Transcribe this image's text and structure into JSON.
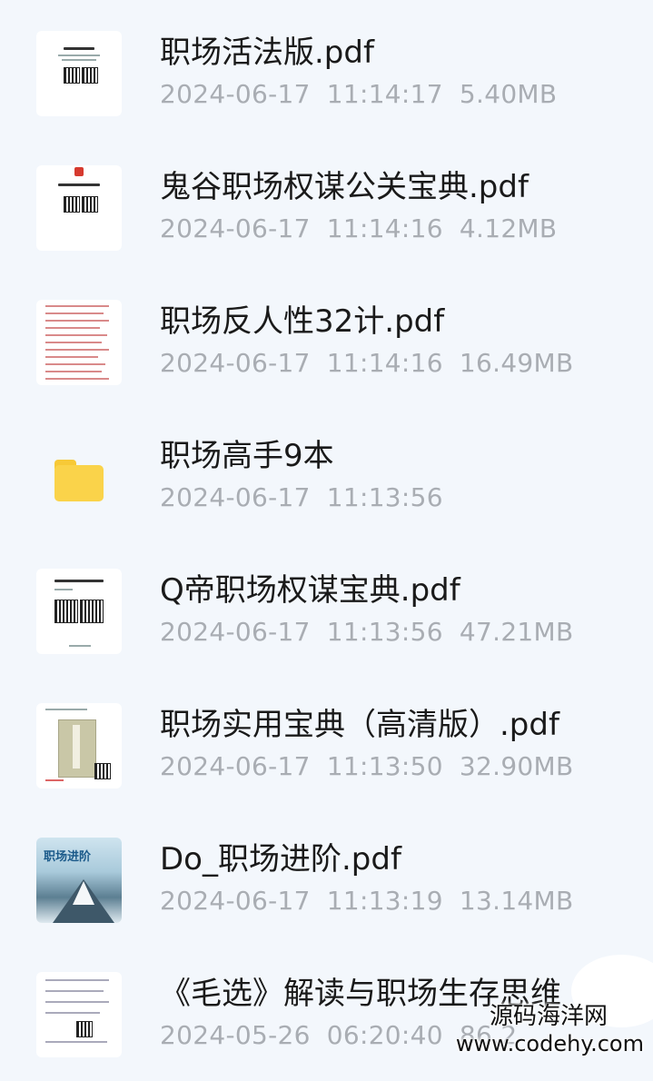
{
  "files": [
    {
      "name": "职场活法版.pdf",
      "date": "2024-06-17",
      "time": "11:14:17",
      "size": "5.40MB",
      "thumb": "pdf-qr-thumbnail"
    },
    {
      "name": "鬼谷职场权谋公关宝典.pdf",
      "date": "2024-06-17",
      "time": "11:14:16",
      "size": "4.12MB",
      "thumb": "pdf-qr-thumbnail"
    },
    {
      "name": "职场反人性32计.pdf",
      "date": "2024-06-17",
      "time": "11:14:16",
      "size": "16.49MB",
      "thumb": "pdf-list-thumbnail"
    },
    {
      "name": "职场高手9本",
      "date": "2024-06-17",
      "time": "11:13:56",
      "size": "",
      "thumb": "folder-icon"
    },
    {
      "name": "Q帝职场权谋宝典.pdf",
      "date": "2024-06-17",
      "time": "11:13:56",
      "size": "47.21MB",
      "thumb": "pdf-qr-thumbnail"
    },
    {
      "name": "职场实用宝典（高清版）.pdf",
      "date": "2024-06-17",
      "time": "11:13:50",
      "size": "32.90MB",
      "thumb": "pdf-book-thumbnail"
    },
    {
      "name": "Do_职场进阶.pdf",
      "date": "2024-06-17",
      "time": "11:13:19",
      "size": "13.14MB",
      "thumb": "pdf-mountain-thumbnail"
    },
    {
      "name": "《毛选》解读与职场生存思维",
      "date": "2024-05-26",
      "time": "06:20:40",
      "size": "86.2",
      "thumb": "pdf-list-thumbnail"
    }
  ],
  "watermark": {
    "cn": "源码海洋网",
    "url": "www.codehy.com"
  },
  "colors": {
    "background": "#f3f7fc",
    "name_text": "#1a1a1a",
    "meta_text": "#a9adb3",
    "folder": "#fad34a"
  }
}
